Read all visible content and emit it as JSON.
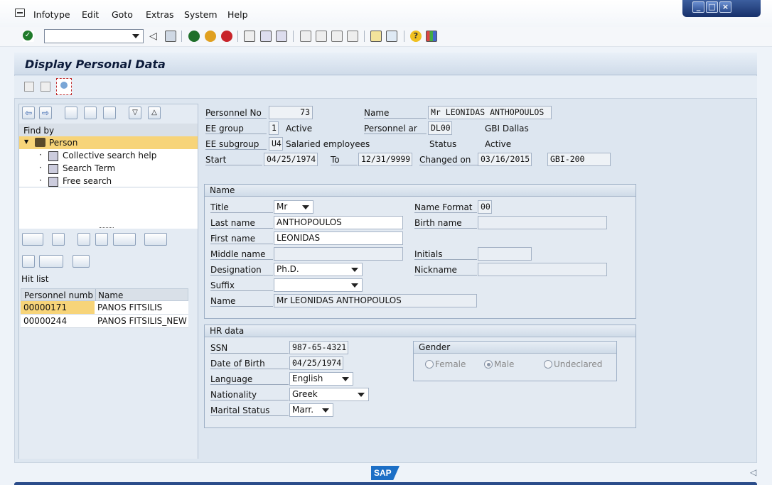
{
  "menu": {
    "items": [
      "Infotype",
      "Edit",
      "Goto",
      "Extras",
      "System",
      "Help"
    ]
  },
  "screen": {
    "title": "Display Personal Data"
  },
  "nav": {
    "find_by": "Find by",
    "tree": [
      {
        "label": "Person"
      },
      {
        "label": "Collective search help"
      },
      {
        "label": "Search Term"
      },
      {
        "label": "Free search"
      }
    ],
    "hit_list": "Hit list",
    "columns": [
      "Personnel numb...",
      "Name"
    ],
    "rows": [
      {
        "number": "00000171",
        "name": "PANOS FITSILIS"
      },
      {
        "number": "00000244",
        "name": "PANOS FITSILIS_NEW"
      }
    ]
  },
  "header": {
    "personnel_no_label": "Personnel No",
    "personnel_no": "73",
    "name_label": "Name",
    "name": "Mr LEONIDAS ANTHOPOULOS",
    "ee_group_label": "EE group",
    "ee_group": "1",
    "ee_group_text": "Active",
    "personnel_area_label": "Personnel ar",
    "personnel_area": "DL00",
    "personnel_area_text": "GBI Dallas",
    "ee_subgroup_label": "EE subgroup",
    "ee_subgroup": "U4",
    "ee_subgroup_text": "Salaried employees",
    "status_label": "Status",
    "status": "Active",
    "start_label": "Start",
    "start": "04/25/1974",
    "to_label": "To",
    "to": "12/31/9999",
    "changed_on_label": "Changed on",
    "changed_on": "03/16/2015",
    "changed_by": "GBI-200"
  },
  "name_group": {
    "title": "Name",
    "title_label": "Title",
    "title_value": "Mr",
    "name_format_label": "Name Format",
    "name_format": "00",
    "last_name_label": "Last name",
    "last_name": "ANTHOPOULOS",
    "birth_name_label": "Birth name",
    "birth_name": "",
    "first_name_label": "First name",
    "first_name": "LEONIDAS",
    "middle_name_label": "Middle name",
    "middle_name": "",
    "initials_label": "Initials",
    "initials": "",
    "designation_label": "Designation",
    "designation": "Ph.D.",
    "nickname_label": "Nickname",
    "nickname": "",
    "suffix_label": "Suffix",
    "suffix": "",
    "name_label": "Name",
    "full_name": "Mr LEONIDAS ANTHOPOULOS"
  },
  "hr_group": {
    "title": "HR data",
    "ssn_label": "SSN",
    "ssn": "987-65-4321",
    "dob_label": "Date of Birth",
    "dob": "04/25/1974",
    "language_label": "Language",
    "language": "English",
    "nationality_label": "Nationality",
    "nationality": "Greek",
    "marital_label": "Marital Status",
    "marital": "Marr.",
    "gender": {
      "title": "Gender",
      "options": [
        "Female",
        "Male",
        "Undeclared"
      ],
      "selected": "Male"
    }
  },
  "footer": {
    "logo": "SAP"
  },
  "colors": {
    "selection": "#f7d479",
    "sap_blue": "#1c6fc6"
  }
}
